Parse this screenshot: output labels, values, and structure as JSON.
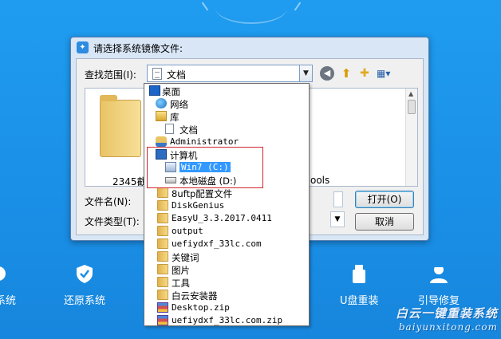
{
  "dialog": {
    "title": "请选择系统镜像文件:",
    "lookin_label": "查找范围(I):",
    "lookin_value": "文档",
    "filename_label": "文件名(N):",
    "filetype_label": "文件类型(T):",
    "open_button": "打开(O)",
    "cancel_button": "取消",
    "folder_name_1": "2345截图",
    "folder_name_2": "ools"
  },
  "dropdown_items": [
    {
      "label": "桌面",
      "icon": "desktop-icon"
    },
    {
      "label": "网络",
      "icon": "network-icon"
    },
    {
      "label": "库",
      "icon": "library-icon"
    },
    {
      "label": "文档",
      "icon": "document-icon"
    },
    {
      "label": "Administrator",
      "icon": "user-folder-icon"
    },
    {
      "label": "计算机",
      "icon": "computer-icon"
    },
    {
      "label": "Win7 (C:)",
      "icon": "system-drive-icon"
    },
    {
      "label": "本地磁盘 (D:)",
      "icon": "drive-icon"
    },
    {
      "label": "8uftp配置文件",
      "icon": "folder-icon"
    },
    {
      "label": "DiskGenius",
      "icon": "folder-icon"
    },
    {
      "label": "EasyU_3.3.2017.0411",
      "icon": "folder-icon"
    },
    {
      "label": "output",
      "icon": "folder-icon"
    },
    {
      "label": "uefiydxf_33lc.com",
      "icon": "folder-icon"
    },
    {
      "label": "关键词",
      "icon": "folder-icon"
    },
    {
      "label": "图片",
      "icon": "folder-icon"
    },
    {
      "label": "工具",
      "icon": "folder-icon"
    },
    {
      "label": "白云安装器",
      "icon": "folder-icon"
    },
    {
      "label": "Desktop.zip",
      "icon": "zip-icon"
    },
    {
      "label": "uefiydxf_33lc.com.zip",
      "icon": "zip-icon"
    }
  ],
  "background_tools": {
    "tool_1": "系统",
    "tool_2": "还原系统",
    "tool_3": "U盘重装",
    "tool_4": "引导修复"
  },
  "watermark": {
    "line1": "白云一键重装系统",
    "line2": "baiyunxitong.com"
  },
  "colors": {
    "background": "#1a8fe6",
    "selection": "#3399ff",
    "highlight_box": "#d2242e"
  }
}
